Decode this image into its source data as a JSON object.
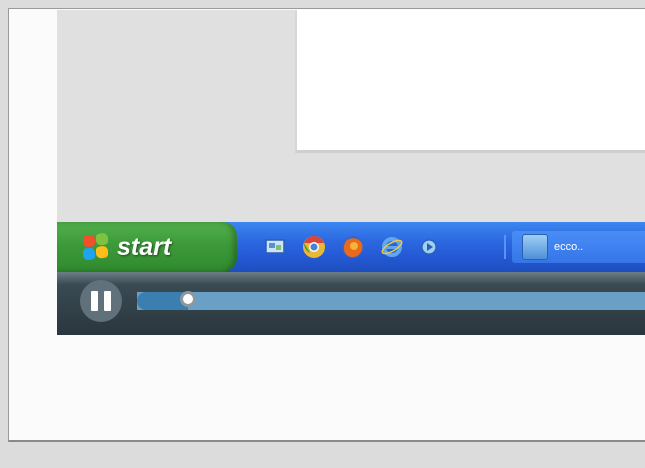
{
  "taskbar": {
    "start_label": "start",
    "quick_launch": [
      {
        "name": "show-desktop-icon",
        "color": "#5a8fd8"
      },
      {
        "name": "chrome-icon",
        "color": "#e8b838"
      },
      {
        "name": "firefox-icon",
        "color": "#e86a1a"
      },
      {
        "name": "internet-explorer-icon",
        "color": "#5fa8ee"
      },
      {
        "name": "media-icon",
        "color": "#9ecff5"
      }
    ],
    "task": {
      "label": "ecco..",
      "icon": "application-icon"
    }
  },
  "player": {
    "state": "playing",
    "control_icon": "pause-icon",
    "progress": 0.1,
    "played_color": "#3b7fb0",
    "track_color": "#6aa0c6"
  },
  "colors": {
    "taskbar_blue": "#2b67e0",
    "start_green": "#3d9a3a",
    "player_dark": "#2a363d"
  }
}
